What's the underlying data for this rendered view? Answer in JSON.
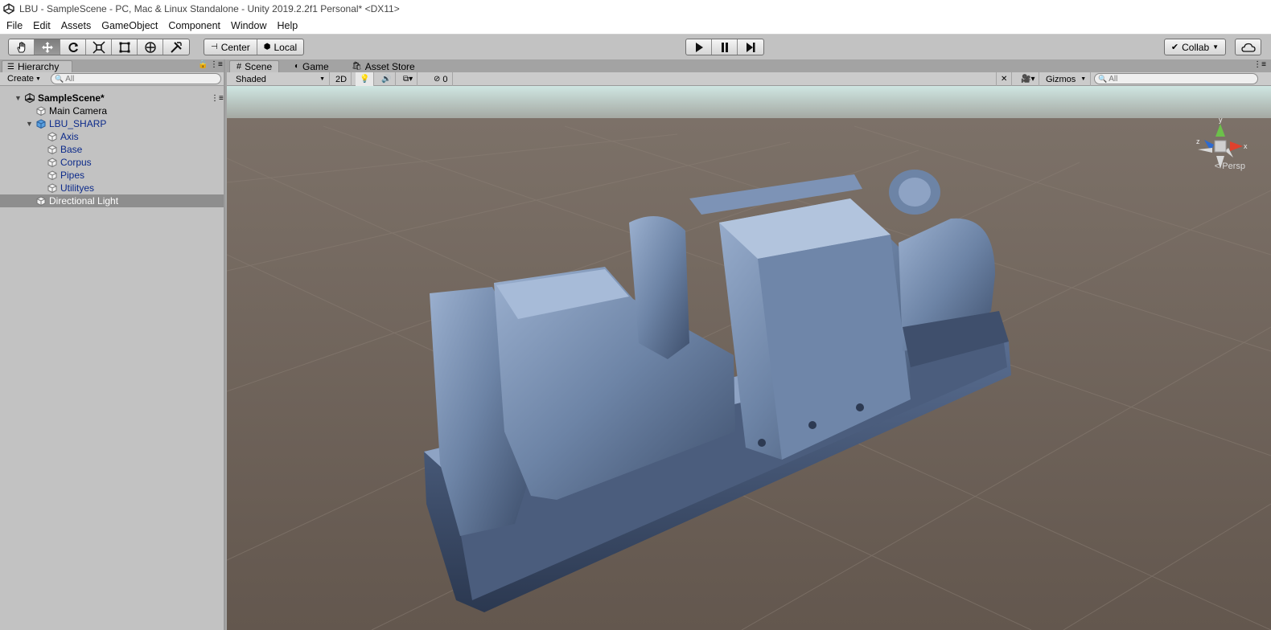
{
  "window": {
    "title": "LBU - SampleScene - PC, Mac & Linux Standalone - Unity 2019.2.2f1 Personal* <DX11>"
  },
  "menu": [
    "File",
    "Edit",
    "Assets",
    "GameObject",
    "Component",
    "Window",
    "Help"
  ],
  "toolbar": {
    "tools": [
      {
        "name": "hand-tool",
        "icon": "hand-icon",
        "active": false
      },
      {
        "name": "move-tool",
        "icon": "move-icon",
        "active": true
      },
      {
        "name": "rotate-tool",
        "icon": "rotate-icon",
        "active": false
      },
      {
        "name": "scale-tool",
        "icon": "scale-icon",
        "active": false
      },
      {
        "name": "rect-tool",
        "icon": "rect-icon",
        "active": false
      },
      {
        "name": "transform-tool",
        "icon": "transform-icon",
        "active": false
      },
      {
        "name": "custom-tool",
        "icon": "custom-tools-icon",
        "active": false
      }
    ],
    "pivot_label": "Center",
    "space_label": "Local",
    "collab_label": "Collab"
  },
  "hierarchy": {
    "tab_label": "Hierarchy",
    "create_label": "Create",
    "search_placeholder": "All",
    "scene_name": "SampleScene*",
    "items": [
      {
        "label": "Main Camera",
        "depth": 1,
        "prefab": false
      },
      {
        "label": "LBU_SHARP",
        "depth": 1,
        "prefab": true,
        "expanded": true
      },
      {
        "label": "Axis",
        "depth": 2,
        "prefab": true
      },
      {
        "label": "Base",
        "depth": 2,
        "prefab": true
      },
      {
        "label": "Corpus",
        "depth": 2,
        "prefab": true
      },
      {
        "label": "Pipes",
        "depth": 2,
        "prefab": true
      },
      {
        "label": "Utilityes",
        "depth": 2,
        "prefab": true
      },
      {
        "label": "Directional Light",
        "depth": 1,
        "prefab": false,
        "selected": true
      }
    ]
  },
  "scene": {
    "tabs": [
      {
        "label": "Scene",
        "icon": "scene-grid-icon",
        "active": true
      },
      {
        "label": "Game",
        "icon": "game-icon",
        "active": false
      },
      {
        "label": "Asset Store",
        "icon": "asset-store-icon",
        "active": false
      }
    ],
    "shading_mode": "Shaded",
    "mode_2d": "2D",
    "hidden_count": "0",
    "gizmos_label": "Gizmos",
    "search_placeholder": "All",
    "projection_label": "Persp"
  },
  "colors": {
    "ground": "#685b52",
    "sky": "#cfe6e2",
    "machine": "#6d84a6",
    "hierarchy_blue": "#0c2a8a"
  }
}
